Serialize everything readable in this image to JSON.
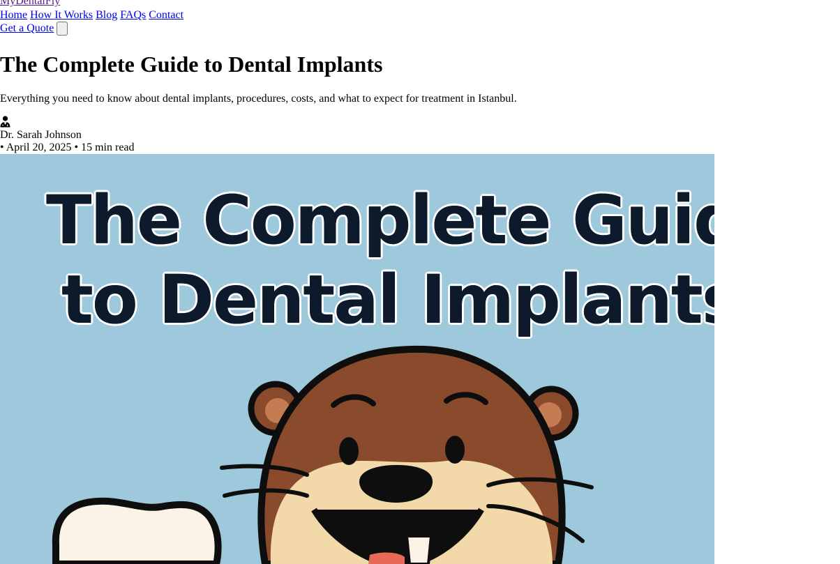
{
  "site": {
    "brand": "MyDentalFly"
  },
  "nav": {
    "items": [
      "Home",
      "How It Works",
      "Blog",
      "FAQs",
      "Contact"
    ],
    "cta": "Get a Quote",
    "menu_icon": "menu-icon"
  },
  "article": {
    "title": "The Complete Guide to Dental Implants",
    "subtitle": "Everything you need to know about dental implants, procedures, costs, and what to expect for treatment in Istanbul.",
    "author_icon": "doctor-icon",
    "author": "Dr. Sarah Johnson",
    "meta": "• April 20, 2025 • 15 min read"
  },
  "hero": {
    "line1": "The Complete Guide",
    "line2": "to Dental Implants",
    "background": "#9ec9dd",
    "text_color": "#0c1a2b",
    "illustration": "cartoon-otter-with-tooth"
  }
}
